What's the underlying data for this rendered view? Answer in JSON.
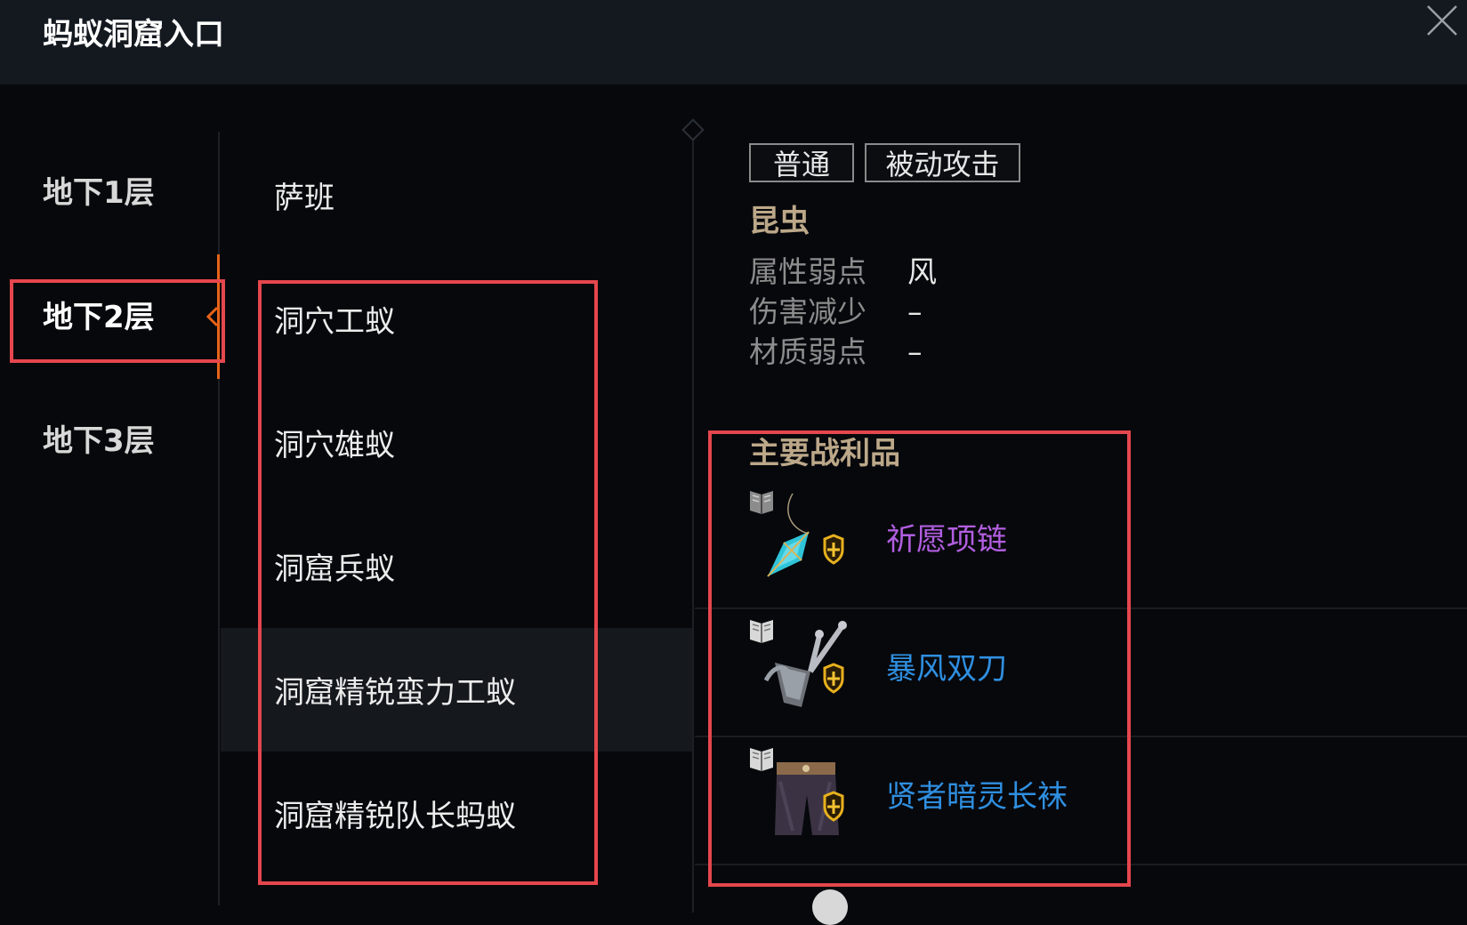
{
  "window": {
    "title": "蚂蚁洞窟入口"
  },
  "floors": [
    {
      "label": "地下1层",
      "active": false
    },
    {
      "label": "地下2层",
      "active": true
    },
    {
      "label": "地下3层",
      "active": false
    }
  ],
  "monsters": [
    {
      "name": "萨班"
    },
    {
      "name": "洞穴工蚁"
    },
    {
      "name": "洞穴雄蚁"
    },
    {
      "name": "洞窟兵蚁"
    },
    {
      "name": "洞窟精锐蛮力工蚁",
      "selected": true
    },
    {
      "name": "洞窟精锐队长蚂蚁"
    }
  ],
  "detail": {
    "tags": [
      "普通",
      "被动攻击"
    ],
    "race": "昆虫",
    "attributes": [
      {
        "label": "属性弱点",
        "value": "风"
      },
      {
        "label": "伤害减少",
        "value": "–"
      },
      {
        "label": "材质弱点",
        "value": "–"
      }
    ],
    "loot_title": "主要战利品",
    "loot": [
      {
        "name": "祈愿项链",
        "color": "#b15ee0",
        "icon": "necklace-icon"
      },
      {
        "name": "暴风双刀",
        "color": "#2f8fe0",
        "icon": "twin-blades-icon"
      },
      {
        "name": "贤者暗灵长袜",
        "color": "#2f8fe0",
        "icon": "pants-icon"
      }
    ]
  },
  "colors": {
    "accent": "#e86418",
    "highlight_box": "#e4474d",
    "race_text": "#bca889"
  }
}
